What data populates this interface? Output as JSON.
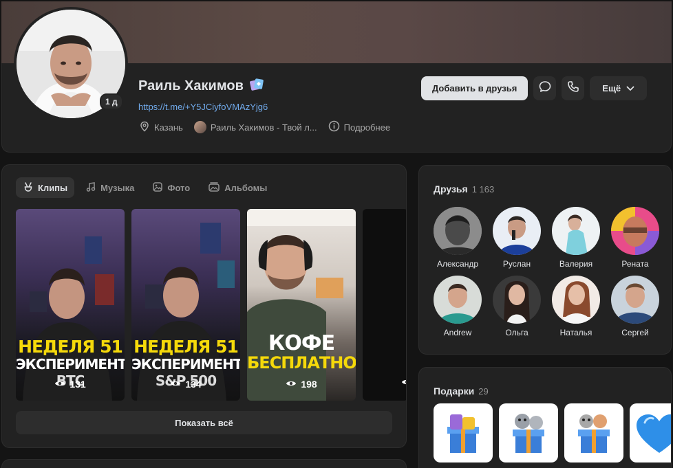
{
  "profile": {
    "name": "Раиль Хакимов",
    "link": "https://t.me/+Y5JCiyfoVMAzYjg6",
    "badge_days": "1 д",
    "location": "Казань",
    "channel": "Раиль Хакимов - Твой л...",
    "more_info": "Подробнее"
  },
  "actions": {
    "add_friend": "Добавить в друзья",
    "more": "Ещё"
  },
  "media": {
    "tabs": [
      {
        "label": "Клипы",
        "active": true
      },
      {
        "label": "Музыка",
        "active": false
      },
      {
        "label": "Фото",
        "active": false
      },
      {
        "label": "Альбомы",
        "active": false
      }
    ],
    "clips": [
      {
        "line1": "НЕДЕЛЯ 51",
        "line2": "ЭКСПЕРИМЕНТ",
        "line3": "BTC",
        "views": "131"
      },
      {
        "line1": "НЕДЕЛЯ 51",
        "line2": "ЭКСПЕРИМЕНТ",
        "line3": "S&P 500",
        "views": "134"
      },
      {
        "line1": "КОФЕ",
        "line2": "БЕСПЛАТНО",
        "line3": "",
        "views": "198"
      }
    ],
    "show_all": "Показать всё"
  },
  "friends": {
    "title": "Друзья",
    "count": "1 163",
    "items": [
      {
        "name": "Александр"
      },
      {
        "name": "Руслан"
      },
      {
        "name": "Валерия"
      },
      {
        "name": "Рената"
      },
      {
        "name": "Andrew"
      },
      {
        "name": "Ольга"
      },
      {
        "name": "Наталья"
      },
      {
        "name": "Сергей"
      }
    ]
  },
  "gifts": {
    "title": "Подарки",
    "count": "29"
  },
  "colors": {
    "link": "#71aaeb",
    "card": "#222222",
    "background": "#141414",
    "clip_yellow": "#f5d90a"
  }
}
